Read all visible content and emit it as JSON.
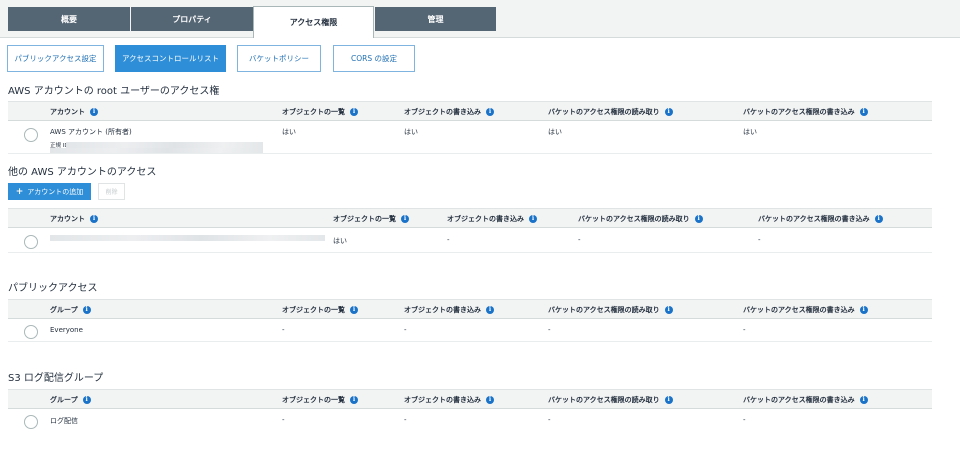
{
  "tabs": [
    {
      "label": "概要"
    },
    {
      "label": "プロパティ"
    },
    {
      "label": "アクセス権限"
    },
    {
      "label": "管理"
    }
  ],
  "subtabs": [
    {
      "label": "パブリックアクセス設定"
    },
    {
      "label": "アクセスコントロールリスト"
    },
    {
      "label": "バケットポリシー"
    },
    {
      "label": "CORS の設定"
    }
  ],
  "root_section": {
    "title": "AWS アカウントの root ユーザーのアクセス権",
    "columns": [
      "アカウント",
      "オブジェクトの一覧",
      "オブジェクトの書き込み",
      "バケットのアクセス権限の読み取り",
      "バケットのアクセス権限の書き込み"
    ],
    "row": {
      "account": "AWS アカウント (所有者)",
      "canonical_label": "正規 ID:",
      "list": "はい",
      "write": "はい",
      "read_acl": "はい",
      "write_acl": "はい"
    }
  },
  "other_section": {
    "title": "他の AWS アカウントのアクセス",
    "add_label": "アカウントの追加",
    "delete_label": "削除",
    "columns": [
      "アカウント",
      "オブジェクトの一覧",
      "オブジェクトの書き込み",
      "バケットのアクセス権限の読み取り",
      "バケットのアクセス権限の書き込み"
    ],
    "row": {
      "list": "はい",
      "write": "-",
      "read_acl": "-",
      "write_acl": "-"
    }
  },
  "public_section": {
    "title": "パブリックアクセス",
    "columns": [
      "グループ",
      "オブジェクトの一覧",
      "オブジェクトの書き込み",
      "バケットのアクセス権限の読み取り",
      "バケットのアクセス権限の書き込み"
    ],
    "row": {
      "group": "Everyone",
      "list": "-",
      "write": "-",
      "read_acl": "-",
      "write_acl": "-"
    }
  },
  "log_section": {
    "title": "S3 ログ配信グループ",
    "columns": [
      "グループ",
      "オブジェクトの一覧",
      "オブジェクトの書き込み",
      "バケットのアクセス権限の読み取り",
      "バケットのアクセス権限の書き込み"
    ],
    "row": {
      "group": "ログ配信",
      "list": "-",
      "write": "-",
      "read_acl": "-",
      "write_acl": "-"
    }
  },
  "colors": {
    "accent": "#2e8ed8",
    "tab_dark": "#546574",
    "info_icon": "#1a73c8"
  }
}
